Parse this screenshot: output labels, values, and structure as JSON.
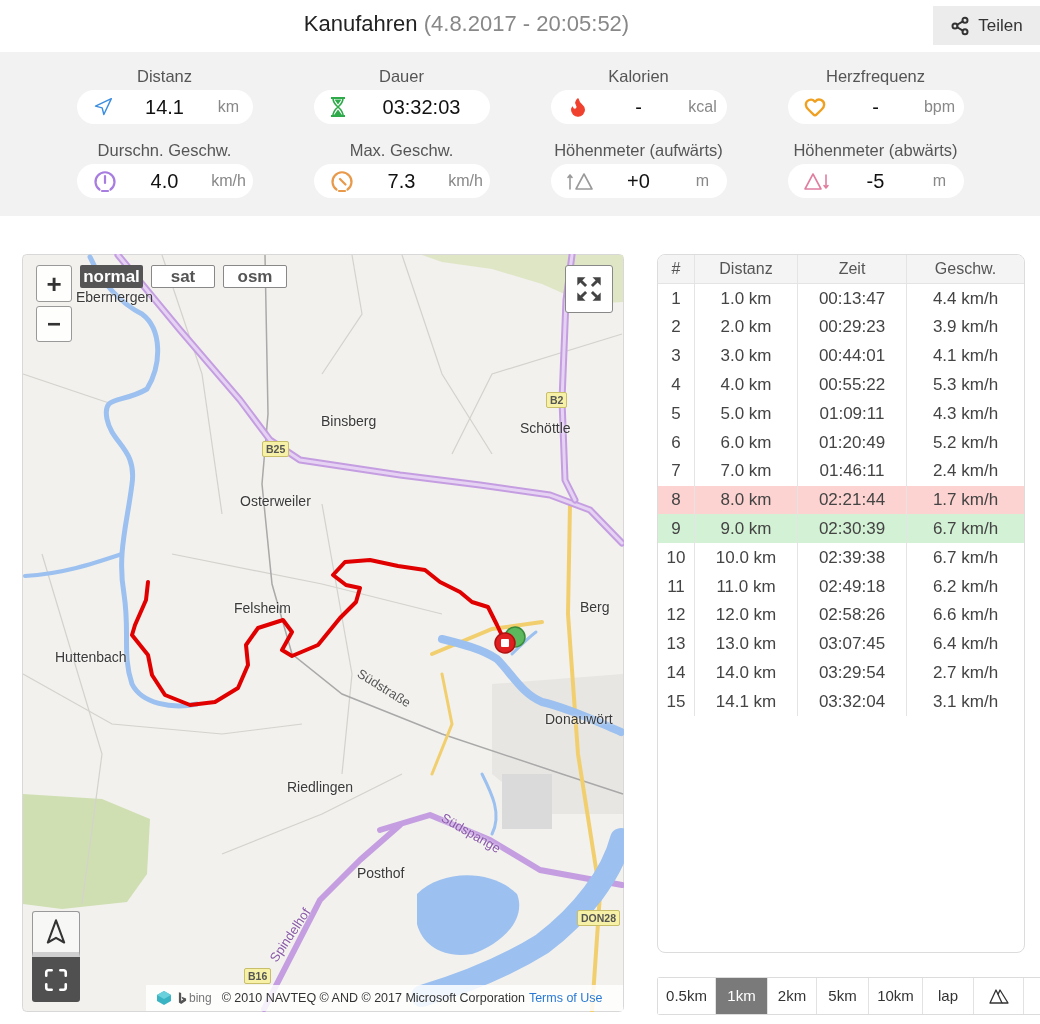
{
  "header": {
    "title": "Kanufahren",
    "subtitle": "(4.8.2017 - 20:05:52)",
    "share_button": "Teilen"
  },
  "stats": [
    {
      "kind": "distance",
      "label": "Distanz",
      "value": "14.1",
      "unit": "km"
    },
    {
      "kind": "duration",
      "label": "Dauer",
      "value": "03:32:03"
    },
    {
      "kind": "calories",
      "label": "Kalorien",
      "value": "-",
      "unit": "kcal"
    },
    {
      "kind": "heart_rate",
      "label": "Herzfrequenz",
      "value": "-",
      "unit": "bpm"
    },
    {
      "kind": "avg_speed",
      "label": "Durschn. Geschw.",
      "value": "4.0",
      "unit": "km/h"
    },
    {
      "kind": "max_speed",
      "label": "Max. Geschw.",
      "value": "7.3",
      "unit": "km/h"
    },
    {
      "kind": "ascent",
      "label": "Höhenmeter (aufwärts)",
      "value": "+0",
      "unit": "m"
    },
    {
      "kind": "descent",
      "label": "Höhenmeter (abwärts)",
      "value": "-5",
      "unit": "m"
    }
  ],
  "map": {
    "zoom_in": "+",
    "zoom_out": "−",
    "layers": [
      {
        "label": "normal",
        "selected": true
      },
      {
        "label": "sat",
        "selected": false
      },
      {
        "label": "osm",
        "selected": false
      }
    ],
    "place_labels": [
      "Ebermergen",
      "Binsberg",
      "Schöttle",
      "Osterweiler",
      "Felsheim",
      "Huttenbach",
      "Berg",
      "Donauwört",
      "Riedlingen",
      "Posthof"
    ],
    "street_labels": [
      "Südstraße",
      "Südspange",
      "Spindelhof"
    ],
    "road_numbers": [
      "B2",
      "B25",
      "B16",
      "DON28"
    ],
    "attribution": {
      "logo": "bing",
      "text": "© 2010 NAVTEQ © AND © 2017 Microsoft Corporation",
      "link": "Terms of Use"
    }
  },
  "splits_table": {
    "columns": [
      "#",
      "Distanz",
      "Zeit",
      "Geschw."
    ],
    "rows": [
      {
        "cells": [
          "1",
          "1.0 km",
          "00:13:47",
          "4.4 km/h"
        ],
        "slowest": false,
        "fastest": false
      },
      {
        "cells": [
          "2",
          "2.0 km",
          "00:29:23",
          "3.9 km/h"
        ],
        "slowest": false,
        "fastest": false
      },
      {
        "cells": [
          "3",
          "3.0 km",
          "00:44:01",
          "4.1 km/h"
        ],
        "slowest": false,
        "fastest": false
      },
      {
        "cells": [
          "4",
          "4.0 km",
          "00:55:22",
          "5.3 km/h"
        ],
        "slowest": false,
        "fastest": false
      },
      {
        "cells": [
          "5",
          "5.0 km",
          "01:09:11",
          "4.3 km/h"
        ],
        "slowest": false,
        "fastest": false
      },
      {
        "cells": [
          "6",
          "6.0 km",
          "01:20:49",
          "5.2 km/h"
        ],
        "slowest": false,
        "fastest": false
      },
      {
        "cells": [
          "7",
          "7.0 km",
          "01:46:11",
          "2.4 km/h"
        ],
        "slowest": false,
        "fastest": false
      },
      {
        "cells": [
          "8",
          "8.0 km",
          "02:21:44",
          "1.7 km/h"
        ],
        "slowest": true,
        "fastest": false
      },
      {
        "cells": [
          "9",
          "9.0 km",
          "02:30:39",
          "6.7 km/h"
        ],
        "slowest": false,
        "fastest": true
      },
      {
        "cells": [
          "10",
          "10.0 km",
          "02:39:38",
          "6.7 km/h"
        ],
        "slowest": false,
        "fastest": false
      },
      {
        "cells": [
          "11",
          "11.0 km",
          "02:49:18",
          "6.2 km/h"
        ],
        "slowest": false,
        "fastest": false
      },
      {
        "cells": [
          "12",
          "12.0 km",
          "02:58:26",
          "6.6 km/h"
        ],
        "slowest": false,
        "fastest": false
      },
      {
        "cells": [
          "13",
          "13.0 km",
          "03:07:45",
          "6.4 km/h"
        ],
        "slowest": false,
        "fastest": false
      },
      {
        "cells": [
          "14",
          "14.0 km",
          "03:29:54",
          "2.7 km/h"
        ],
        "slowest": false,
        "fastest": false
      },
      {
        "cells": [
          "15",
          "14.1 km",
          "03:32:04",
          "3.1 km/h"
        ],
        "slowest": false,
        "fastest": false
      }
    ]
  },
  "intervals": [
    {
      "kind": "label",
      "label": "0.5km",
      "selected": false
    },
    {
      "kind": "label",
      "label": "1km",
      "selected": true
    },
    {
      "kind": "label",
      "label": "2km",
      "selected": false
    },
    {
      "kind": "label",
      "label": "5km",
      "selected": false
    },
    {
      "kind": "label",
      "label": "10km",
      "selected": false
    },
    {
      "kind": "label",
      "label": "lap",
      "selected": false
    },
    {
      "kind": "elevation",
      "selected": false
    }
  ]
}
